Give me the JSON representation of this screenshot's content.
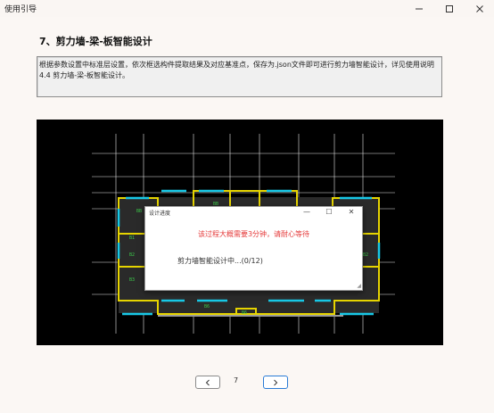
{
  "window": {
    "title": "使用引导",
    "minimize_icon": "minimize-icon",
    "maximize_icon": "maximize-icon",
    "close_icon": "close-icon"
  },
  "content": {
    "heading": "7、剪力墙-梁-板智能设计",
    "description": "根据参数设置中标准层设置，依次框选构件提取结果及对应基准点，保存为.json文件即可进行剪力墙智能设计，详见使用说明 4.4 剪力墙-梁-板智能设计。"
  },
  "drawing": {
    "labels": [
      "BB",
      "BB",
      "B1",
      "B2",
      "B3",
      "B2",
      "B6",
      "B6"
    ]
  },
  "dialog": {
    "title": "设计进度",
    "warning": "该过程大概需要3分钟，请耐心等待",
    "progress_text": "剪力墙智能设计中...(0/12)",
    "minimize": "—",
    "maximize": "☐",
    "close": "✕"
  },
  "pagination": {
    "page": "7",
    "prev_icon": "chevron-left-icon",
    "next_icon": "chevron-right-icon"
  },
  "colors": {
    "accent": "#2a7bd6",
    "wall": "#e6d400",
    "beam": "#18c8e6",
    "warning": "#e53a3a"
  }
}
